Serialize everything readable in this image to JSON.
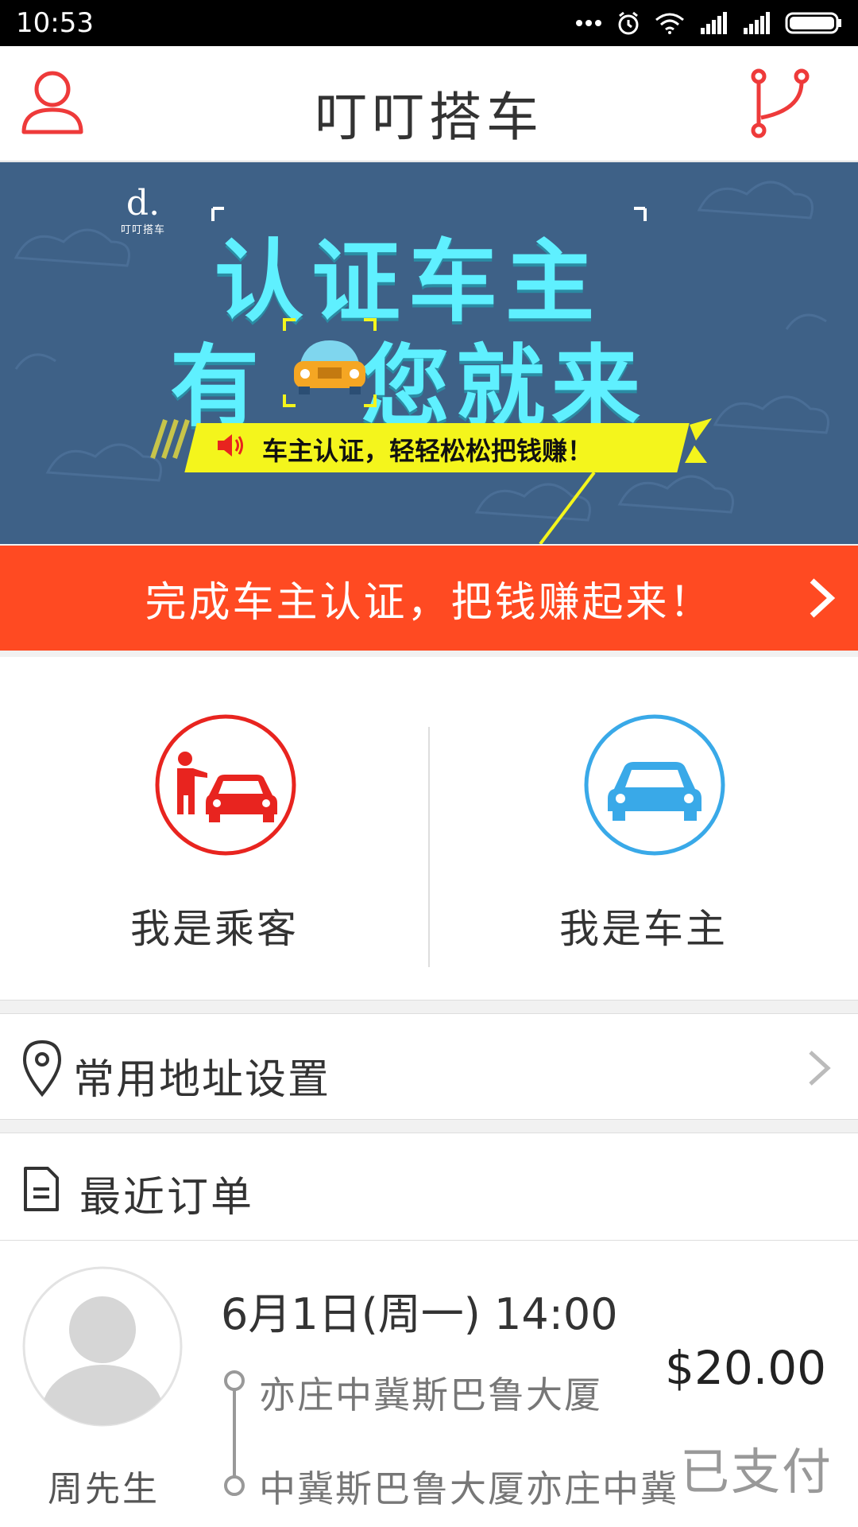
{
  "status_bar": {
    "time": "10:53",
    "icons": [
      "more-dots-icon",
      "alarm-icon",
      "wifi-icon",
      "signal-icon",
      "signal-icon",
      "battery-icon"
    ]
  },
  "header": {
    "title": "叮叮搭车",
    "left_icon": "profile-icon",
    "right_icon": "route-icon"
  },
  "banner": {
    "logo_text": "叮叮搭车",
    "line1": "认证车主",
    "line2_a": "有",
    "line2_b": "您就来",
    "strip_text": "车主认证，轻轻松松把钱赚！"
  },
  "promo": {
    "text": "完成车主认证，把钱赚起来！"
  },
  "roles": {
    "passenger": "我是乘客",
    "driver": "我是车主"
  },
  "address": {
    "label": "常用地址设置"
  },
  "orders": {
    "title": "最近订单",
    "items": [
      {
        "time": "6月1日(周一) 14:00",
        "from": "亦庄中冀斯巴鲁大厦",
        "to": "中冀斯巴鲁大厦亦庄中冀",
        "price": "$20.00",
        "status": "已支付",
        "name": "周先生"
      }
    ]
  },
  "colors": {
    "accent_red": "#ff4a22",
    "passenger_red": "#e8241f",
    "driver_blue": "#39a9e8",
    "banner_bg": "#3e6187",
    "banner_text": "#5ff0ff",
    "strip_yellow": "#f4f51c"
  }
}
